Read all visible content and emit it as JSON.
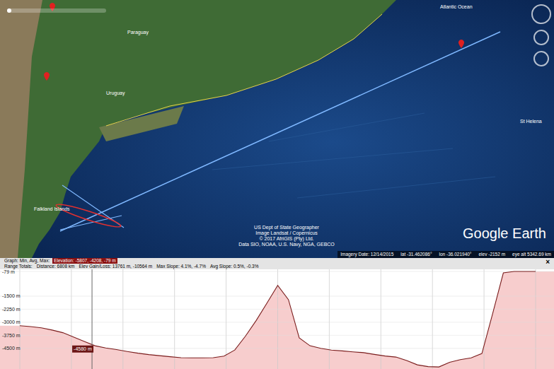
{
  "map": {
    "labels": [
      {
        "text": "Paraguay"
      },
      {
        "text": "Uruguay"
      },
      {
        "text": "Atlantic Ocean"
      },
      {
        "text": "St Helena"
      },
      {
        "text": "Falkland Islands"
      }
    ],
    "attribution": [
      "US Dept of State Geographer",
      "Image Landsat / Copernicus",
      "© 2017 AfriGIS (Pty) Ltd.",
      "Data SIO, NOAA, U.S. Navy, NGA, GEBCO"
    ],
    "logo": "Google Earth",
    "status_bar": {
      "imagery_date": "Imagery Date: 12/14/2015",
      "lat": "lat -31.462086°",
      "lon": "lon -36.021940°",
      "elev": "elev -2152 m",
      "eye_alt": "eye alt 5342.69 km"
    }
  },
  "profile": {
    "graph_label": "Graph: Min, Avg, Max:",
    "elevation": "Elevation: -5807, -4208, -79 m",
    "range_label": "Range Totals:",
    "distance": "Distance: 6808 km",
    "gain_loss": "Elev Gain/Loss: 13761 m, -10564 m",
    "max_slope": "Max Slope: 4.1%, -4.7%",
    "avg_slope": "Avg Slope: 0.5%, -0.3%",
    "close": "×",
    "y_ticks": [
      "-79 m",
      "-1500 m",
      "-2250 m",
      "-3000 m",
      "-3750 m",
      "-4500 m"
    ],
    "cursor": {
      "reading": "-4580 m",
      "level": 0.14
    },
    "series": [
      -3200,
      -3250,
      -3320,
      -3450,
      -3600,
      -3850,
      -4100,
      -4350,
      -4480,
      -4570,
      -4680,
      -4780,
      -4860,
      -4920,
      -4980,
      -5040,
      -5050,
      -5050,
      -5040,
      -4950,
      -4600,
      -3800,
      -2900,
      -1900,
      -880,
      -1700,
      -3900,
      -4350,
      -4500,
      -4600,
      -4650,
      -4700,
      -4750,
      -4850,
      -4940,
      -5000,
      -5200,
      -5450,
      -5550,
      -5570,
      -5300,
      -5150,
      -5050,
      -4800,
      -2500,
      -160,
      -79,
      -79,
      -79
    ]
  }
}
